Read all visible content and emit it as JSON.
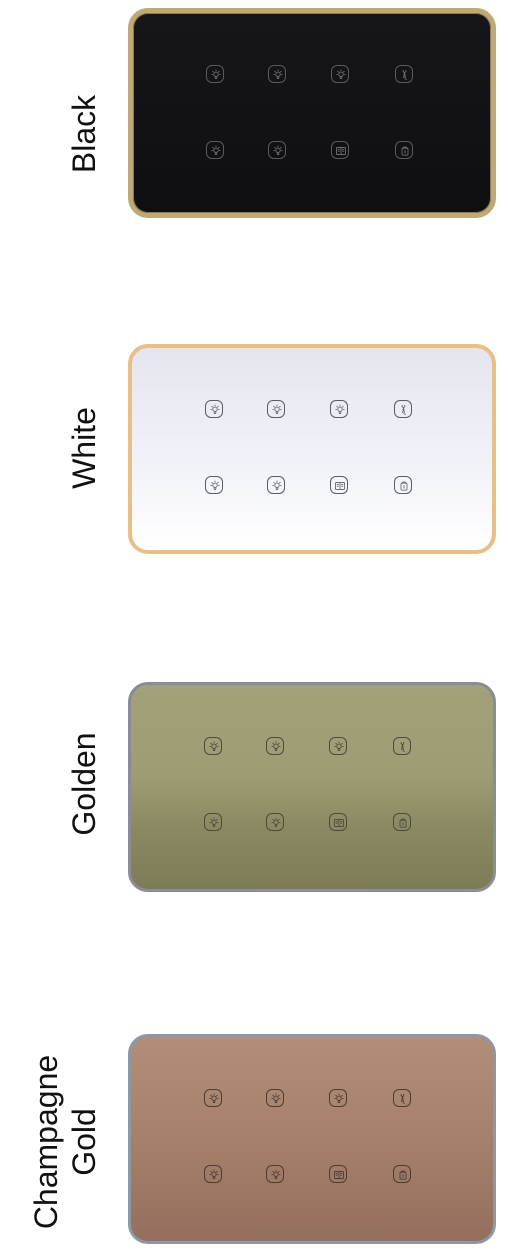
{
  "finishes": [
    {
      "id": "black",
      "label_lines": [
        "Black"
      ]
    },
    {
      "id": "white",
      "label_lines": [
        "White"
      ]
    },
    {
      "id": "golden",
      "label_lines": [
        "Golden"
      ]
    },
    {
      "id": "champagne",
      "label_lines": [
        "Champagne",
        "Gold"
      ]
    }
  ],
  "buttons": {
    "top_row": [
      "light-bulb-icon",
      "light-bulb-icon",
      "light-bulb-icon",
      "curtain-icon"
    ],
    "bottom_row": [
      "light-bulb-icon",
      "light-bulb-icon",
      "book-icon",
      "do-not-disturb-icon"
    ]
  }
}
